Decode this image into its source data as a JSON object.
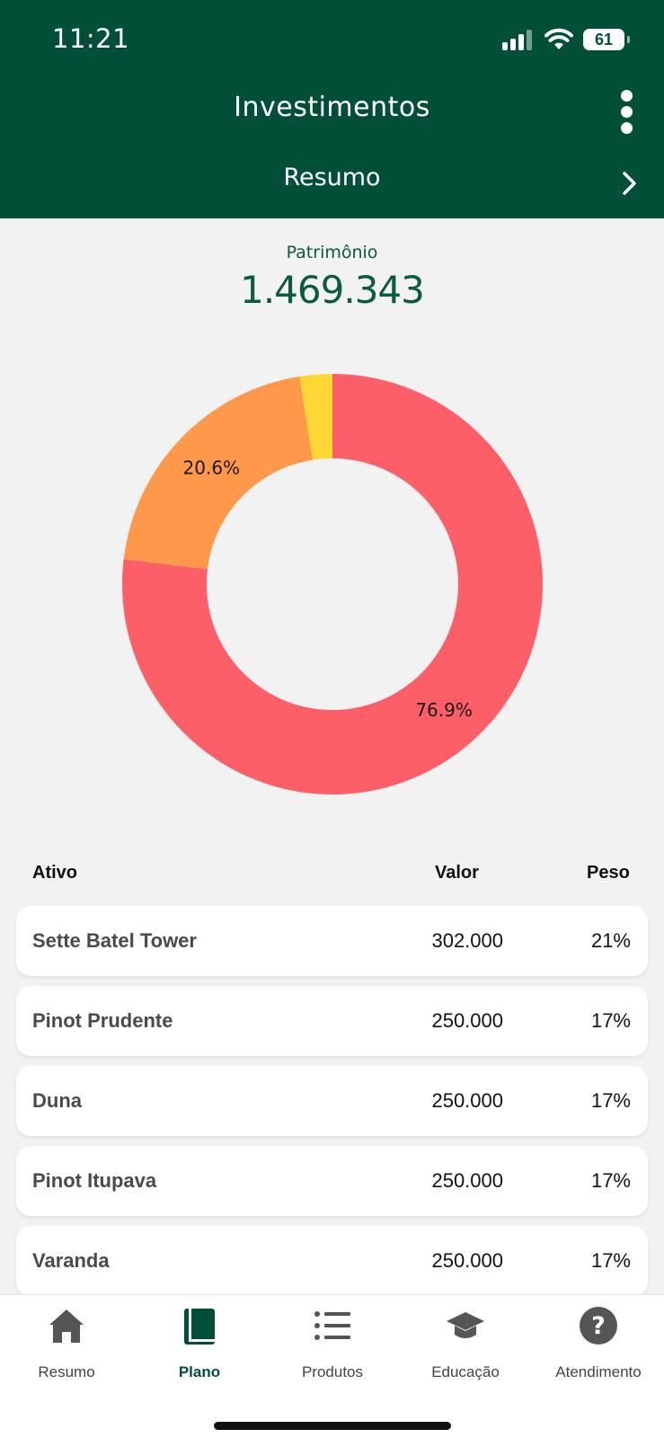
{
  "status_bar": {
    "time": "11:21",
    "battery": "61"
  },
  "header": {
    "title": "Investimentos",
    "subtitle": "Resumo"
  },
  "summary": {
    "label": "Patrimônio",
    "value": "1.469.343"
  },
  "colors": {
    "brand": "#024f38",
    "slice_1": "#fc5f68",
    "slice_2": "#fe984a",
    "slice_3": "#fed735"
  },
  "chart_data": {
    "type": "pie",
    "variant": "donut",
    "values": [
      76.9,
      20.6,
      2.5
    ],
    "labels": [
      "76.9%",
      "20.6%",
      ""
    ],
    "colors": [
      "#fc5f68",
      "#fe984a",
      "#fed735"
    ]
  },
  "table": {
    "headers": {
      "asset": "Ativo",
      "value": "Valor",
      "weight": "Peso"
    },
    "rows": [
      {
        "name": "Sette Batel Tower",
        "value": "302.000",
        "weight": "21%"
      },
      {
        "name": "Pinot Prudente",
        "value": "250.000",
        "weight": "17%"
      },
      {
        "name": "Duna",
        "value": "250.000",
        "weight": "17%"
      },
      {
        "name": "Pinot Itupava",
        "value": "250.000",
        "weight": "17%"
      },
      {
        "name": "Varanda",
        "value": "250.000",
        "weight": "17%"
      }
    ]
  },
  "tabbar": {
    "items": [
      {
        "label": "Resumo",
        "icon": "home-icon"
      },
      {
        "label": "Plano",
        "icon": "book-icon",
        "active": true
      },
      {
        "label": "Produtos",
        "icon": "list-icon"
      },
      {
        "label": "Educação",
        "icon": "graduation-cap-icon"
      },
      {
        "label": "Atendimento",
        "icon": "help-icon"
      }
    ]
  }
}
